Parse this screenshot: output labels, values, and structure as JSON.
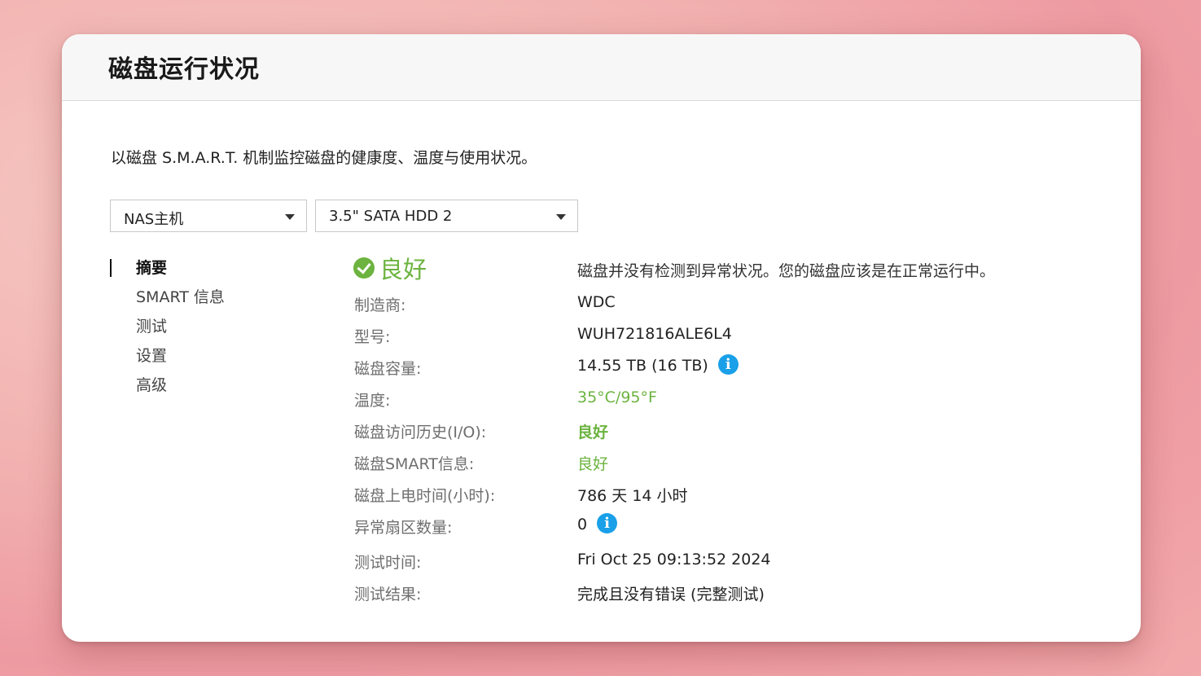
{
  "window": {
    "title": "磁盘运行状况",
    "description": "以磁盘 S.M.A.R.T. 机制监控磁盘的健康度、温度与使用状况。"
  },
  "selectors": {
    "host": "NAS主机",
    "disk": "3.5\" SATA HDD 2"
  },
  "nav": {
    "items": [
      {
        "label": "摘要",
        "active": true
      },
      {
        "label": "SMART 信息",
        "active": false
      },
      {
        "label": "测试",
        "active": false
      },
      {
        "label": "设置",
        "active": false
      },
      {
        "label": "高级",
        "active": false
      }
    ]
  },
  "summary": {
    "status": "良好",
    "status_icon": "check-circle-icon",
    "status_description": "磁盘并没有检测到异常状况。您的磁盘应该是在正常运行中。",
    "rows": [
      {
        "label": "制造商:",
        "value": "WDC"
      },
      {
        "label": "型号:",
        "value": "WUH721816ALE6L4"
      },
      {
        "label": "磁盘容量:",
        "value": "14.55 TB (16 TB)"
      },
      {
        "label": "温度:",
        "value": "35°C/95°F"
      },
      {
        "label": "磁盘访问历史(I/O):",
        "value": "良好"
      },
      {
        "label": "磁盘SMART信息:",
        "value": "良好"
      },
      {
        "label": "磁盘上电时间(小时):",
        "value": "786 天 14 小时"
      },
      {
        "label": "异常扇区数量:",
        "value": "0"
      },
      {
        "label": "测试时间:",
        "value": "Fri Oct 25 09:13:52 2024"
      },
      {
        "label": "测试结果:",
        "value": "完成且没有错误 (完整测试)"
      }
    ],
    "info_icon_glyph": "i"
  },
  "colors": {
    "good_green": "#6cb33f",
    "info_blue": "#19a0e8"
  }
}
